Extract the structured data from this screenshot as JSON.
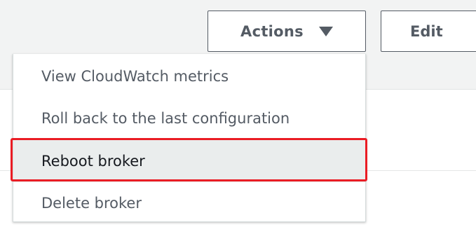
{
  "toolbar": {
    "actions_label": "Actions",
    "edit_label": "Edit"
  },
  "actions_menu": {
    "items": [
      {
        "label": "View CloudWatch metrics"
      },
      {
        "label": "Roll back to the last configuration"
      },
      {
        "label": "Reboot broker",
        "highlighted": true
      },
      {
        "label": "Delete broker"
      }
    ]
  },
  "colors": {
    "button_border": "#545b64",
    "highlight_bg": "#eaeded",
    "annotation_red": "#ea1c24"
  },
  "icons": {
    "actions_caret": "caret-down-icon"
  }
}
